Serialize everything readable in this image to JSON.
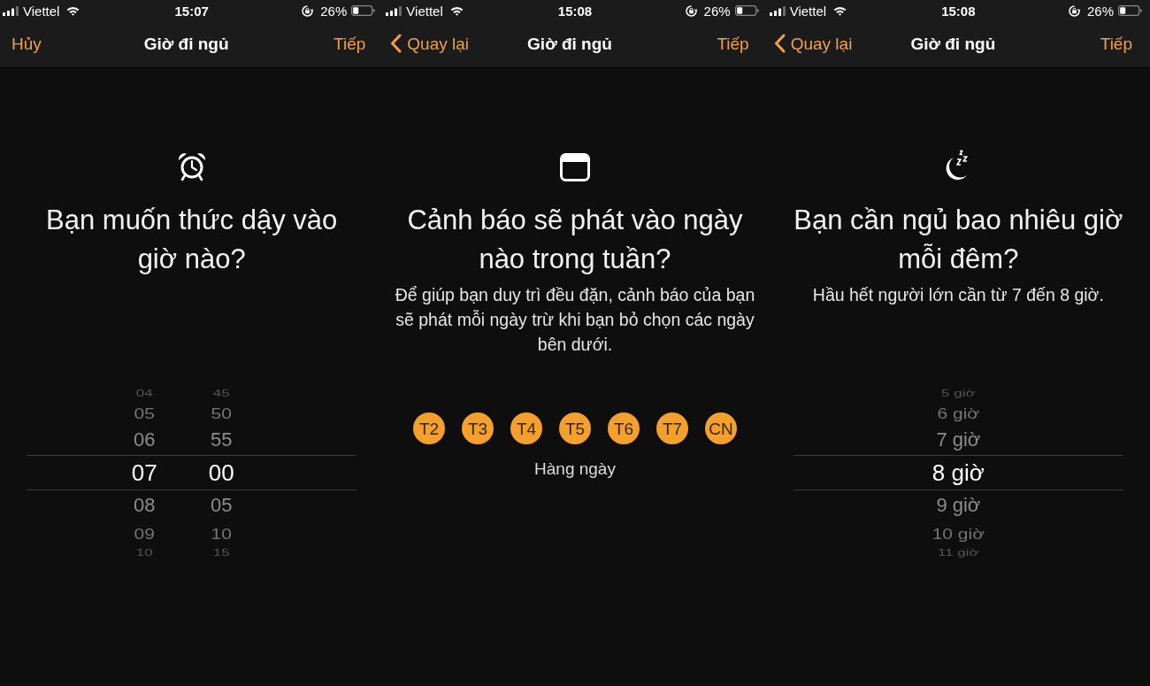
{
  "screens": [
    {
      "kind": "time_picker",
      "status_bar": {
        "carrier": "Viettel",
        "time": "15:07",
        "battery": "26%"
      },
      "nav": {
        "left": {
          "kind": "cancel",
          "label": "Hủy"
        },
        "title": "Giờ đi ngủ",
        "right": "Tiếp"
      },
      "heading": "Bạn muốn thức dậy vào giờ nào?",
      "picker": {
        "columns": [
          {
            "items": [
              {
                "label": "04",
                "selected": false
              },
              {
                "label": "05",
                "selected": false
              },
              {
                "label": "06",
                "selected": false
              },
              {
                "label": "07",
                "selected": true
              },
              {
                "label": "08",
                "selected": false
              },
              {
                "label": "09",
                "selected": false
              },
              {
                "label": "10",
                "selected": false
              }
            ]
          },
          {
            "items": [
              {
                "label": "45",
                "selected": false
              },
              {
                "label": "50",
                "selected": false
              },
              {
                "label": "55",
                "selected": false
              },
              {
                "label": "00",
                "selected": true
              },
              {
                "label": "05",
                "selected": false
              },
              {
                "label": "10",
                "selected": false
              },
              {
                "label": "15",
                "selected": false
              }
            ]
          }
        ]
      }
    },
    {
      "kind": "day_picker",
      "status_bar": {
        "carrier": "Viettel",
        "time": "15:08",
        "battery": "26%"
      },
      "nav": {
        "left": {
          "kind": "back",
          "label": "Quay lại"
        },
        "title": "Giờ đi ngủ",
        "right": "Tiếp"
      },
      "heading": "Cảnh báo sẽ phát vào ngày nào trong tuần?",
      "description": "Để giúp bạn duy trì đều đặn, cảnh báo của bạn sẽ phát mỗi ngày trừ khi bạn bỏ chọn các ngày bên dưới.",
      "days": [
        {
          "label": "T2",
          "selected": true
        },
        {
          "label": "T3",
          "selected": true
        },
        {
          "label": "T4",
          "selected": true
        },
        {
          "label": "T5",
          "selected": true
        },
        {
          "label": "T6",
          "selected": true
        },
        {
          "label": "T7",
          "selected": true
        },
        {
          "label": "CN",
          "selected": true
        }
      ],
      "summary": "Hàng ngày"
    },
    {
      "kind": "duration_picker",
      "status_bar": {
        "carrier": "Viettel",
        "time": "15:08",
        "battery": "26%"
      },
      "nav": {
        "left": {
          "kind": "back",
          "label": "Quay lại"
        },
        "title": "Giờ đi ngủ",
        "right": "Tiếp"
      },
      "heading": "Bạn cần ngủ bao nhiêu giờ mỗi đêm?",
      "description": "Hầu hết người lớn cần từ 7 đến 8 giờ.",
      "picker": {
        "columns": [
          {
            "items": [
              {
                "label": "5 giờ",
                "selected": false
              },
              {
                "label": "6 giờ",
                "selected": false
              },
              {
                "label": "7 giờ",
                "selected": false
              },
              {
                "label": "8 giờ",
                "selected": true
              },
              {
                "label": "9 giờ",
                "selected": false
              },
              {
                "label": "10 giờ",
                "selected": false
              },
              {
                "label": "11 giờ",
                "selected": false
              }
            ]
          }
        ]
      }
    }
  ]
}
